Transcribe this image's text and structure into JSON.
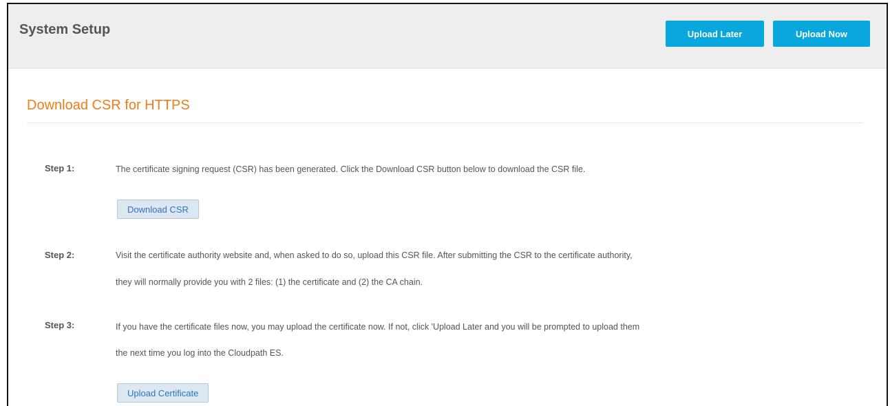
{
  "header": {
    "title": "System Setup",
    "upload_later_label": "Upload Later",
    "upload_now_label": "Upload Now"
  },
  "section": {
    "title": "Download CSR for HTTPS"
  },
  "steps": [
    {
      "label": "Step 1:",
      "lines": [
        "The certificate signing request (CSR) has been generated. Click the Download CSR button below to download the CSR file."
      ],
      "button_label": "Download CSR"
    },
    {
      "label": "Step 2:",
      "lines": [
        "Visit the certificate authority website and, when asked to do so, upload this CSR file. After submitting the CSR to the certificate authority,",
        "they will normally provide you with 2 files: (1) the certificate and (2) the CA chain."
      ]
    },
    {
      "label": "Step 3:",
      "lines": [
        "If you have the certificate files now, you may upload the certificate now. If not, click 'Upload Later and you will be prompted to upload them",
        "the next time you log into the Cloudpath ES."
      ],
      "button_label": "Upload Certificate"
    }
  ],
  "colors": {
    "accent_button": "#0aa6de",
    "section_title": "#f07c16",
    "secondary_button_bg": "#dde7f1",
    "secondary_button_text": "#2b75c0"
  }
}
